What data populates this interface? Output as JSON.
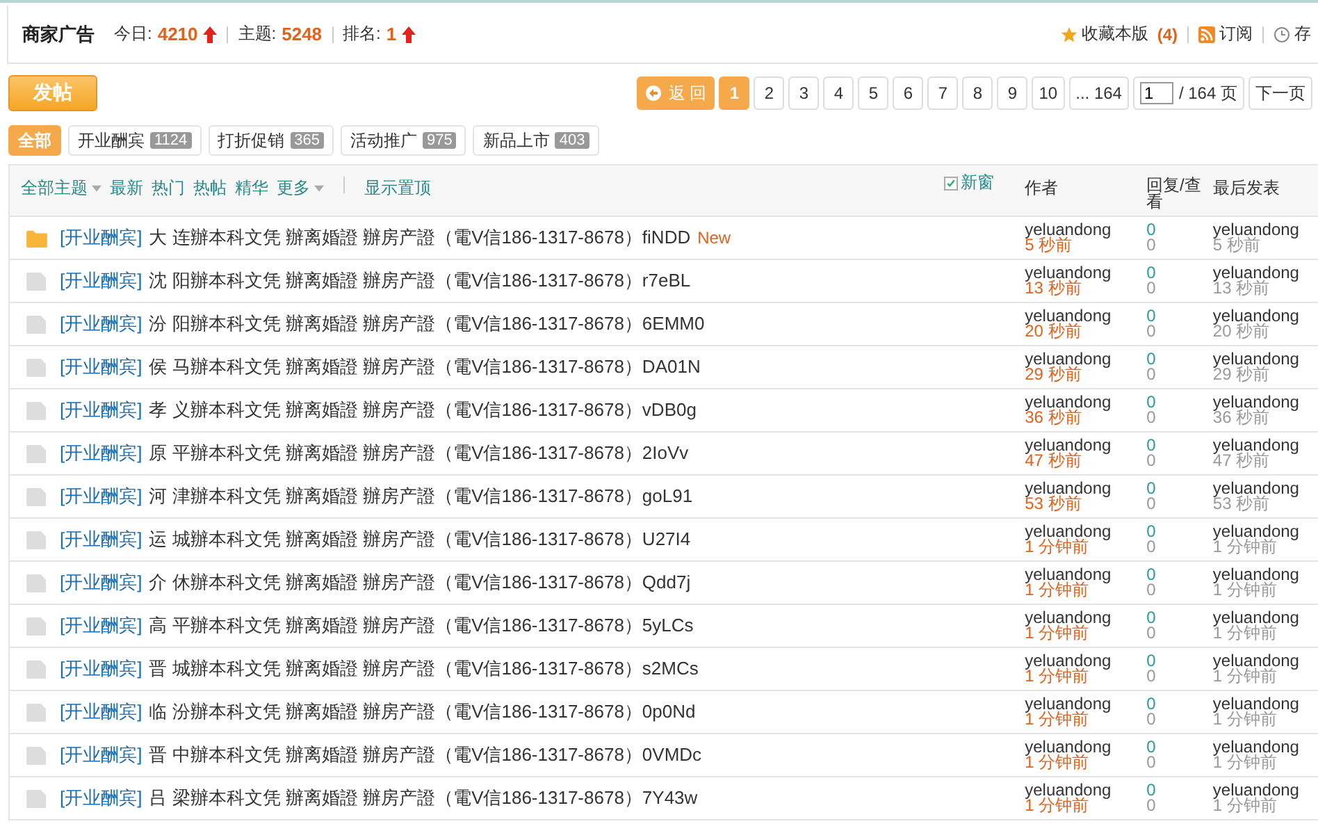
{
  "forum_header": {
    "title": "商家广告",
    "stats": [
      {
        "label": "今日:",
        "value": "4210",
        "up": true
      },
      {
        "label": "主题:",
        "value": "5248"
      },
      {
        "label": "排名:",
        "value": "1",
        "up": true
      }
    ],
    "actions": [
      {
        "kind": "star",
        "label": "收藏本版",
        "count": "(4)"
      },
      {
        "kind": "rss",
        "label": "订阅"
      },
      {
        "kind": "clock",
        "label": "存"
      }
    ]
  },
  "post_button": "发帖",
  "pagination": {
    "back": "返 回",
    "pages": [
      {
        "label": "1",
        "selected": true
      },
      {
        "label": "2",
        "selected": false
      },
      {
        "label": "3",
        "selected": false
      },
      {
        "label": "4",
        "selected": false
      },
      {
        "label": "5",
        "selected": false
      },
      {
        "label": "6",
        "selected": false
      },
      {
        "label": "7",
        "selected": false
      },
      {
        "label": "8",
        "selected": false
      },
      {
        "label": "9",
        "selected": false
      },
      {
        "label": "10",
        "selected": false
      },
      {
        "label": "... 164",
        "selected": false
      }
    ],
    "page_input": "1",
    "total": "/ 164 页",
    "next": "下一页"
  },
  "tabs": [
    {
      "label": "全部",
      "selected": true
    },
    {
      "label": "开业酬宾",
      "count": "1124",
      "selected": false
    },
    {
      "label": "打折促销",
      "count": "365",
      "selected": false
    },
    {
      "label": "活动推广",
      "count": "975",
      "selected": false
    },
    {
      "label": "新品上市",
      "count": "403",
      "selected": false
    }
  ],
  "filters": [
    {
      "label": "全部主题",
      "dropdown": true
    },
    {
      "label": "最新",
      "dropdown": false
    },
    {
      "label": "热门",
      "dropdown": false
    },
    {
      "label": "热帖",
      "dropdown": false
    },
    {
      "label": "精华",
      "dropdown": false
    },
    {
      "label": "更多",
      "dropdown": true
    }
  ],
  "show_sticky": "显示置顶",
  "new_window": {
    "label": "新窗",
    "checked": true
  },
  "columns": [
    "作者",
    "回复/查看",
    "最后发表"
  ],
  "rows": [
    {
      "new": true,
      "category": "[开业酬宾]",
      "title": "大 连辦本科文凭 辦离婚證 辦房产證（電V信186-1317-8678）fiNDD",
      "badge": "New",
      "author": "yeluandong",
      "time": "5 秒前",
      "replies": "0",
      "views": "0",
      "last_author": "yeluandong",
      "last_time": "5 秒前"
    },
    {
      "new": false,
      "category": "[开业酬宾]",
      "title": "沈 阳辦本科文凭 辦离婚證 辦房产證（電V信186-1317-8678）r7eBL",
      "author": "yeluandong",
      "time": "13 秒前",
      "replies": "0",
      "views": "0",
      "last_author": "yeluandong",
      "last_time": "13 秒前"
    },
    {
      "new": false,
      "category": "[开业酬宾]",
      "title": "汾 阳辦本科文凭 辦离婚證 辦房产證（電V信186-1317-8678）6EMM0",
      "author": "yeluandong",
      "time": "20 秒前",
      "replies": "0",
      "views": "0",
      "last_author": "yeluandong",
      "last_time": "20 秒前"
    },
    {
      "new": false,
      "category": "[开业酬宾]",
      "title": "侯 马辦本科文凭 辦离婚證 辦房产證（電V信186-1317-8678）DA01N",
      "author": "yeluandong",
      "time": "29 秒前",
      "replies": "0",
      "views": "0",
      "last_author": "yeluandong",
      "last_time": "29 秒前"
    },
    {
      "new": false,
      "category": "[开业酬宾]",
      "title": "孝 义辦本科文凭 辦离婚證 辦房产證（電V信186-1317-8678）vDB0g",
      "author": "yeluandong",
      "time": "36 秒前",
      "replies": "0",
      "views": "0",
      "last_author": "yeluandong",
      "last_time": "36 秒前"
    },
    {
      "new": false,
      "category": "[开业酬宾]",
      "title": "原 平辦本科文凭 辦离婚證 辦房产證（電V信186-1317-8678）2IoVv",
      "author": "yeluandong",
      "time": "47 秒前",
      "replies": "0",
      "views": "0",
      "last_author": "yeluandong",
      "last_time": "47 秒前"
    },
    {
      "new": false,
      "category": "[开业酬宾]",
      "title": "河 津辦本科文凭 辦离婚證 辦房产證（電V信186-1317-8678）goL91",
      "author": "yeluandong",
      "time": "53 秒前",
      "replies": "0",
      "views": "0",
      "last_author": "yeluandong",
      "last_time": "53 秒前"
    },
    {
      "new": false,
      "category": "[开业酬宾]",
      "title": "运 城辦本科文凭 辦离婚證 辦房产證（電V信186-1317-8678）U27I4",
      "author": "yeluandong",
      "time": "1 分钟前",
      "replies": "0",
      "views": "0",
      "last_author": "yeluandong",
      "last_time": "1 分钟前"
    },
    {
      "new": false,
      "category": "[开业酬宾]",
      "title": "介 休辦本科文凭 辦离婚證 辦房产證（電V信186-1317-8678）Qdd7j",
      "author": "yeluandong",
      "time": "1 分钟前",
      "replies": "0",
      "views": "0",
      "last_author": "yeluandong",
      "last_time": "1 分钟前"
    },
    {
      "new": false,
      "category": "[开业酬宾]",
      "title": "高 平辦本科文凭 辦离婚證 辦房产證（電V信186-1317-8678）5yLCs",
      "author": "yeluandong",
      "time": "1 分钟前",
      "replies": "0",
      "views": "0",
      "last_author": "yeluandong",
      "last_time": "1 分钟前"
    },
    {
      "new": false,
      "category": "[开业酬宾]",
      "title": "晋 城辦本科文凭 辦离婚證 辦房产證（電V信186-1317-8678）s2MCs",
      "author": "yeluandong",
      "time": "1 分钟前",
      "replies": "0",
      "views": "0",
      "last_author": "yeluandong",
      "last_time": "1 分钟前"
    },
    {
      "new": false,
      "category": "[开业酬宾]",
      "title": "临 汾辦本科文凭 辦离婚證 辦房产證（電V信186-1317-8678）0p0Nd",
      "author": "yeluandong",
      "time": "1 分钟前",
      "replies": "0",
      "views": "0",
      "last_author": "yeluandong",
      "last_time": "1 分钟前"
    },
    {
      "new": false,
      "category": "[开业酬宾]",
      "title": "晋 中辦本科文凭 辦离婚證 辦房产證（電V信186-1317-8678）0VMDc",
      "author": "yeluandong",
      "time": "1 分钟前",
      "replies": "0",
      "views": "0",
      "last_author": "yeluandong",
      "last_time": "1 分钟前"
    },
    {
      "new": false,
      "category": "[开业酬宾]",
      "title": "吕 梁辦本科文凭 辦离婚證 辦房产證（電V信186-1317-8678）7Y43w",
      "author": "yeluandong",
      "time": "1 分钟前",
      "replies": "0",
      "views": "0",
      "last_author": "yeluandong",
      "last_time": "1 分钟前"
    }
  ]
}
